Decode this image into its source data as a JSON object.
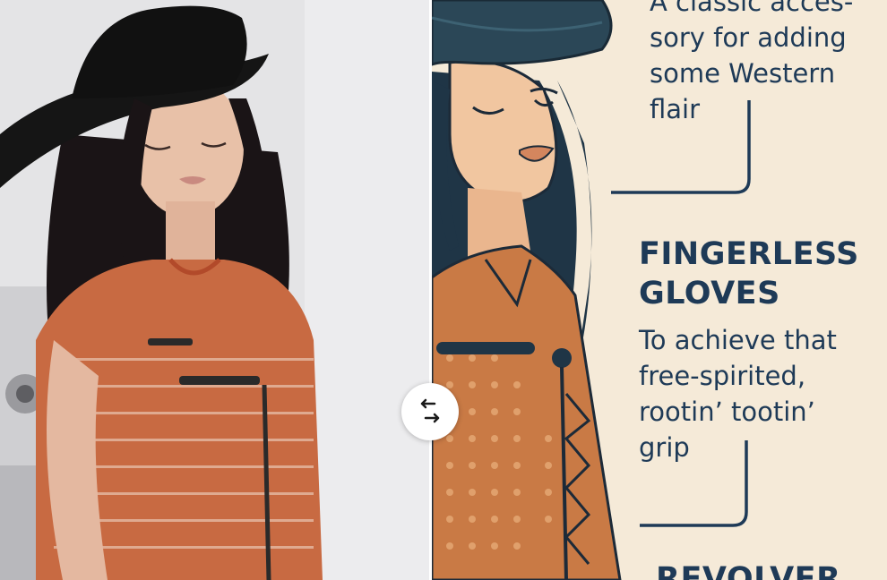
{
  "colors": {
    "text": "#1e3a57",
    "illustration_bg": "#f5ead8",
    "vest": "#c0693c",
    "hat": "#2a4656"
  },
  "left_pane": {
    "image": "photo-original"
  },
  "right_pane": {
    "image": "illustration",
    "callouts": [
      {
        "heading": "",
        "text": "A classic acces-\nsory for adding\nsome Western\nflair"
      },
      {
        "heading": "FINGERLESS\nGLOVES",
        "text": "To achieve that\nfree-spirited,\nrootin’ tootin’\ngrip"
      },
      {
        "heading": "REVOLVER",
        "text": ""
      }
    ]
  },
  "compare_toggle": {
    "icon": "swap-arrows-icon"
  }
}
